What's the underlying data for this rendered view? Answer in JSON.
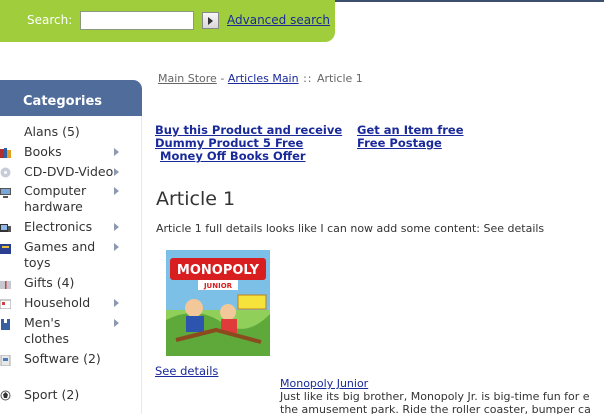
{
  "search": {
    "label": "Search:",
    "value": "",
    "placeholder": "",
    "advanced_label": "Advanced search"
  },
  "sidebar": {
    "title": "Categories",
    "items": [
      {
        "label": "Alans (5)",
        "has_submenu": false,
        "icon": "alans-icon"
      },
      {
        "label": "Books",
        "has_submenu": true,
        "icon": "books-icon"
      },
      {
        "label": "CD-DVD-Video",
        "has_submenu": true,
        "icon": "cd-dvd-icon"
      },
      {
        "label": "Computer hardware",
        "has_submenu": true,
        "icon": "computer-icon"
      },
      {
        "label": "Electronics",
        "has_submenu": true,
        "icon": "electronics-icon"
      },
      {
        "label": "Games and toys",
        "has_submenu": true,
        "icon": "games-icon"
      },
      {
        "label": "Gifts (4)",
        "has_submenu": false,
        "icon": "gifts-icon"
      },
      {
        "label": "Household",
        "has_submenu": true,
        "icon": "household-icon"
      },
      {
        "label": "Men's clothes",
        "has_submenu": true,
        "icon": "mens-clothes-icon"
      },
      {
        "label": "Software (2)",
        "has_submenu": false,
        "icon": "software-icon"
      },
      {
        "label": "Sport (2)",
        "has_submenu": false,
        "icon": "sport-icon"
      }
    ]
  },
  "breadcrumb": {
    "main_store": "Main Store",
    "sep1": " - ",
    "articles_main": "Articles Main",
    "sep2": " :: ",
    "current": "Article 1"
  },
  "promos": {
    "left_line1": "Buy this Product and receive",
    "left_line2": "Dummy Product 5 Free",
    "left_line3": "Money Off Books Offer",
    "right_line1": "Get an Item free",
    "right_line2": "Free Postage"
  },
  "article": {
    "title": "Article 1",
    "intro": "Article 1 full details looks like I can now add some content: See details",
    "see_details": "See details",
    "product_image_alt": "MONOPOLY JUNIOR",
    "product_image_line1": "MONOPOLY",
    "product_image_line2": "JUNIOR",
    "related_title": "Monopoly Junior",
    "related_desc": "Just like its big brother, Monopoly Jr. is big-time fun for e the amusement park. Ride the roller coaster, bumper ca"
  },
  "colors": {
    "search_bar": "#9fcd3c",
    "category_header": "#4f6c9a",
    "link": "#1a2a9a"
  }
}
